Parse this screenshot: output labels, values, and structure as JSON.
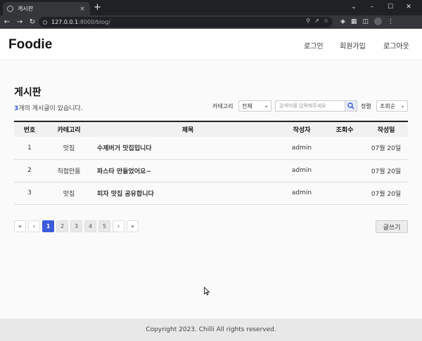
{
  "browser": {
    "tab_title": "게시판",
    "tab_close": "×",
    "new_tab": "+",
    "url_host": "127.0.0.1",
    "url_path": ":8000/blog/",
    "window_controls": [
      "⌄",
      "–",
      "☐",
      "✕"
    ]
  },
  "site": {
    "logo": "Foodie",
    "nav": {
      "login": "로그인",
      "signup": "회원가입",
      "logout": "로그아웃"
    }
  },
  "board": {
    "title": "게시판",
    "count": "3",
    "count_suffix": "개의 게시글이 있습니다.",
    "filters": {
      "category_label": "카테고리",
      "category_value": "전체",
      "search_placeholder": "검색어를 입력해주세요",
      "sort_label": "정렬",
      "sort_value": "조회순"
    },
    "columns": [
      "번호",
      "카테고리",
      "제목",
      "작성자",
      "조회수",
      "작성일"
    ],
    "rows": [
      {
        "no": "1",
        "category": "맛집",
        "title": "수제버거 맛집입니다",
        "author": "admin",
        "views": "",
        "date": "07월 20일"
      },
      {
        "no": "2",
        "category": "직접만듦",
        "title": "파스타 만들었어요~",
        "author": "admin",
        "views": "",
        "date": "07월 20일"
      },
      {
        "no": "3",
        "category": "맛집",
        "title": "피자 맛집 공유합니다",
        "author": "admin",
        "views": "",
        "date": "07월 20일"
      }
    ],
    "pagination": {
      "first": "«",
      "prev": "‹",
      "pages": [
        "1",
        "2",
        "3",
        "4",
        "5"
      ],
      "current_page": "1",
      "next": "›",
      "last": "»"
    },
    "write_button": "글쓰기"
  },
  "footer": {
    "text": "Copyright 2023. Chilli All rights reserved."
  },
  "colors": {
    "accent": "#3b5bdb",
    "chrome_dark": "#202124",
    "chrome_tab": "#35363a"
  }
}
